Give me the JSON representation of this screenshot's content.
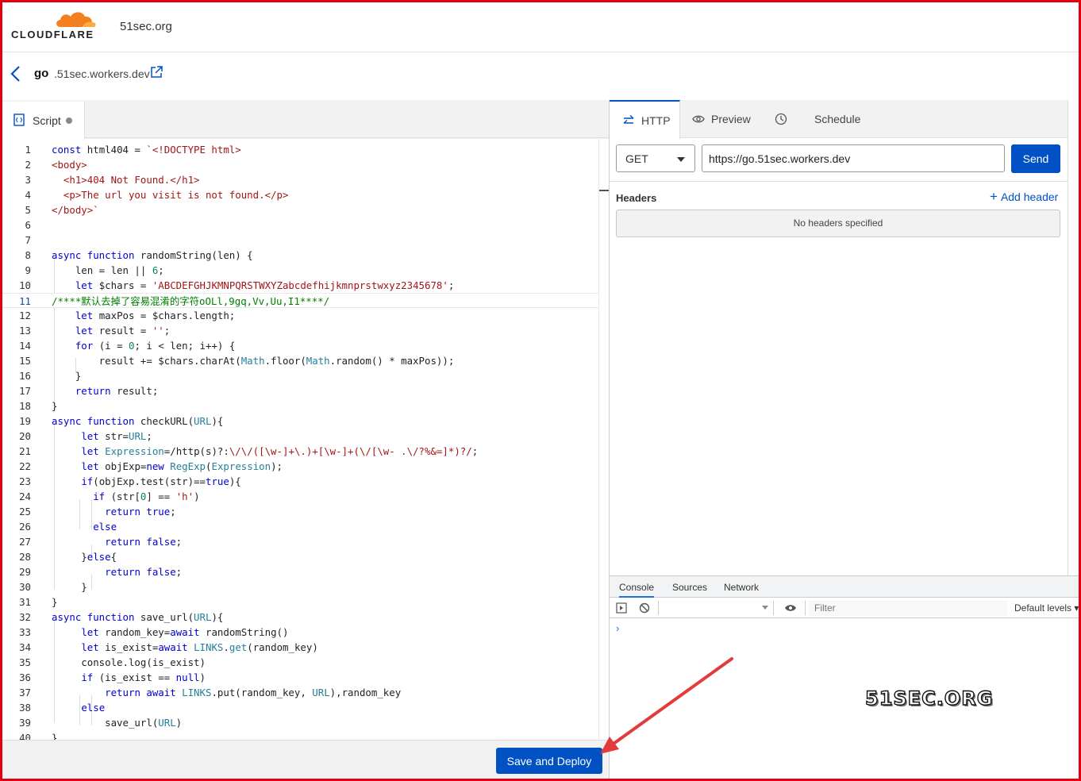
{
  "brand": {
    "logo_text": "CLOUDFLARE",
    "site": "51sec.org",
    "logo_color": "#f38020"
  },
  "worker": {
    "name": "go",
    "domain": ".51sec.workers.dev"
  },
  "editor": {
    "tab_label": "Script",
    "deploy_label": "Save and Deploy",
    "line_numbers": [
      "1",
      "2",
      "3",
      "4",
      "5",
      "6",
      "7",
      "8",
      "9",
      "10",
      "11",
      "12",
      "13",
      "14",
      "15",
      "16",
      "17",
      "18",
      "19",
      "20",
      "21",
      "22",
      "23",
      "24",
      "25",
      "26",
      "27",
      "28",
      "29",
      "30",
      "31",
      "32",
      "33",
      "34",
      "35",
      "36",
      "37",
      "38",
      "39",
      "40"
    ]
  },
  "http": {
    "tabs": [
      "HTTP",
      "Preview",
      "Schedule"
    ],
    "method": "GET",
    "url": "https://go.51sec.workers.dev",
    "send_label": "Send",
    "headers_title": "Headers",
    "add_header_label": "Add header",
    "no_headers_text": "No headers specified"
  },
  "devtools": {
    "tabs": [
      "Console",
      "Sources",
      "Network"
    ],
    "filter_placeholder": "Filter",
    "levels_label": "Default levels",
    "prompt": "›"
  },
  "watermark": "51SEC.ORG",
  "colors": {
    "accent": "#0051c3",
    "frame": "#e3000f",
    "arrow": "#e23b3b"
  }
}
